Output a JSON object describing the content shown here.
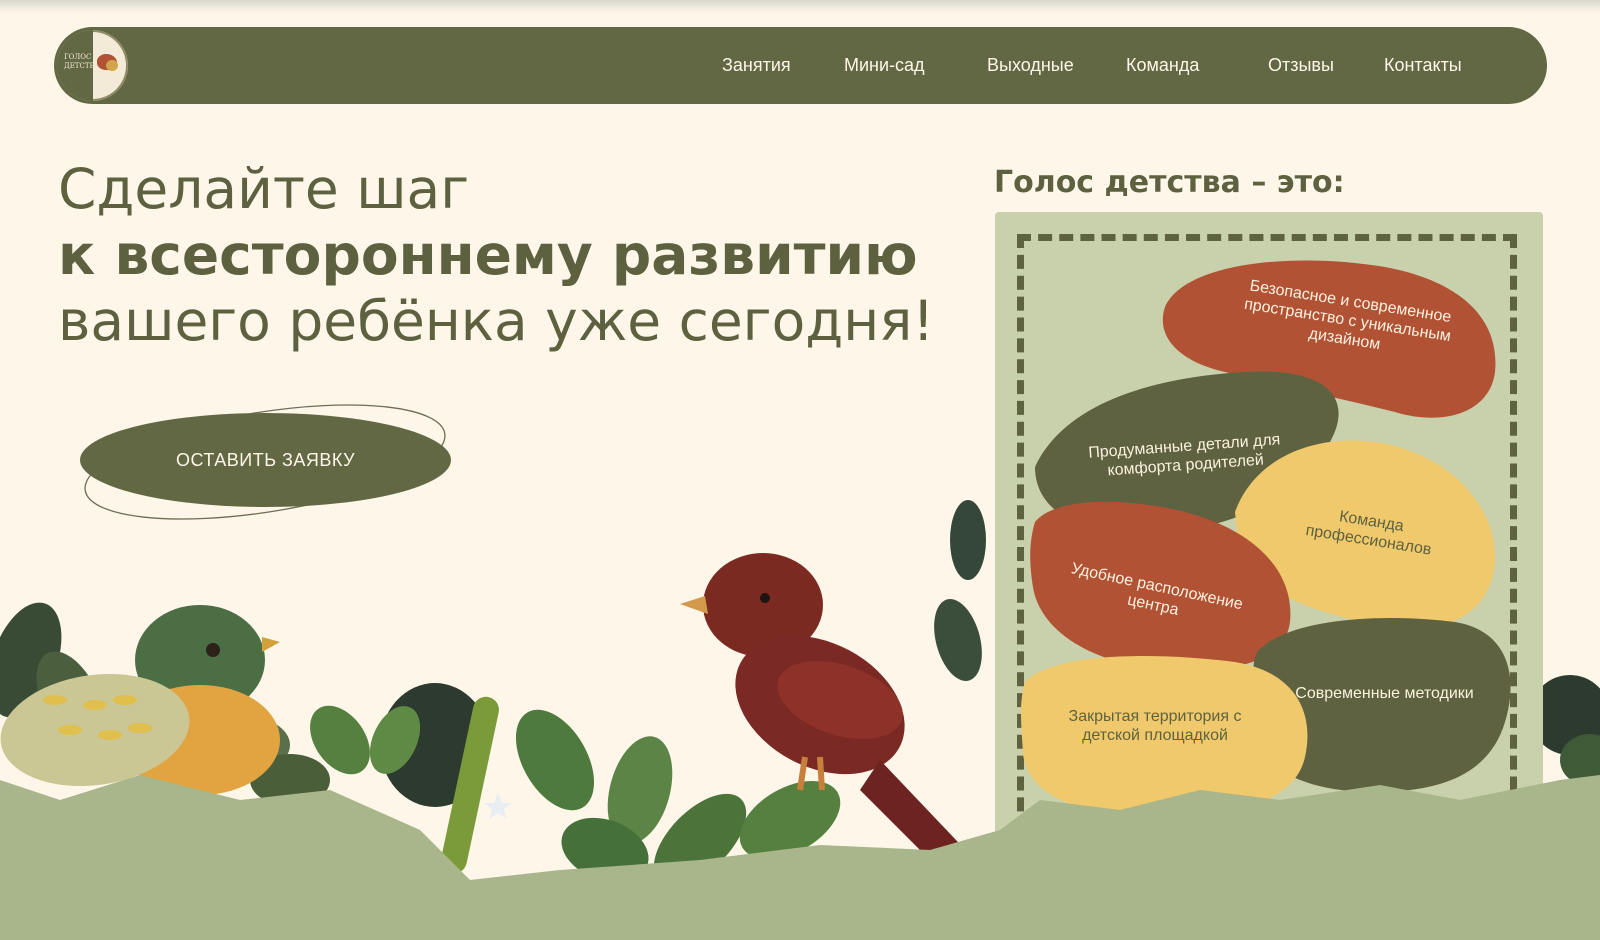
{
  "nav": {
    "logo_text": "ГОЛОС ДЕТСТВА",
    "items": [
      {
        "label": "Занятия"
      },
      {
        "label": "Мини-сад"
      },
      {
        "label": "Выходные"
      },
      {
        "label": "Команда"
      },
      {
        "label": "Отзывы"
      },
      {
        "label": "Контакты"
      }
    ]
  },
  "hero": {
    "line1": "Сделайте шаг",
    "line2": "к всестороннему развитию",
    "line3": "вашего ребёнка уже сегодня!",
    "cta_label": "ОСТАВИТЬ ЗАЯВКУ"
  },
  "features": {
    "title": "Голос детства – это:",
    "items": [
      {
        "label": "Безопасное и современное пространство с уникальным дизайном"
      },
      {
        "label": "Продуманные детали для комфорта родителей"
      },
      {
        "label": "Команда профессионалов"
      },
      {
        "label": "Удобное расположение центра"
      },
      {
        "label": "Современные методики"
      },
      {
        "label": "Закрытая территория с детской площадкой"
      }
    ]
  },
  "colors": {
    "background": "#fdf6e9",
    "olive": "#636844",
    "rust": "#b15235",
    "mustard": "#efc96b",
    "sage": "#c9d0ac",
    "ground": "#a9b58a"
  },
  "icons": [
    "logo-bird-icon",
    "green-bird-illustration",
    "red-bird-illustration",
    "leaf-illustration"
  ]
}
